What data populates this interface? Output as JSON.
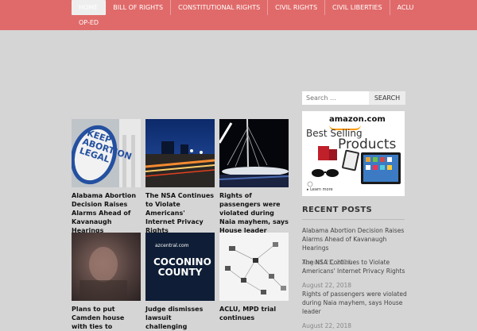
{
  "nav": {
    "items": [
      {
        "label": "HOME"
      },
      {
        "label": "BILL OF RIGHTS"
      },
      {
        "label": "CONSTITUTIONAL RIGHTS"
      },
      {
        "label": "CIVIL RIGHTS"
      },
      {
        "label": "CIVIL LIBERTIES"
      },
      {
        "label": "ACLU"
      }
    ],
    "row2": [
      {
        "label": "OP-ED"
      }
    ]
  },
  "search": {
    "placeholder": "Search …",
    "button_label": "SEARCH"
  },
  "ad": {
    "logo": "amazon.com",
    "line1": "Best Selling",
    "line2": "Products",
    "learn_more": "▸ Learn more"
  },
  "posts": [
    {
      "title": "Alabama Abortion Decision Raises Alarms Ahead of Kavanaugh Hearings",
      "thumb_text": "KEEP ABORTION LEGAL"
    },
    {
      "title": "The NSA Continues to Violate Americans' Internet Privacy Rights"
    },
    {
      "title": "Rights of passengers were violated during Naia mayhem, says House leader"
    },
    {
      "title": "Plans to put Camden house with ties to"
    },
    {
      "title": "Judge dismisses lawsuit challenging",
      "thumb_brand": "azcentral.com",
      "thumb_text": "COCONINO COUNTY"
    },
    {
      "title": "ACLU, MPD trial continues"
    }
  ],
  "recent": {
    "title": "RECENT POSTS",
    "items": [
      {
        "title": "Alabama Abortion Decision Raises Alarms Ahead of Kavanaugh Hearings",
        "date": "August 23, 2018"
      },
      {
        "title": "The NSA Continues to Violate Americans' Internet Privacy Rights",
        "date": "August 22, 2018"
      },
      {
        "title": "Rights of passengers were violated during Naia mayhem, says House leader",
        "date": "August 22, 2018"
      }
    ]
  }
}
